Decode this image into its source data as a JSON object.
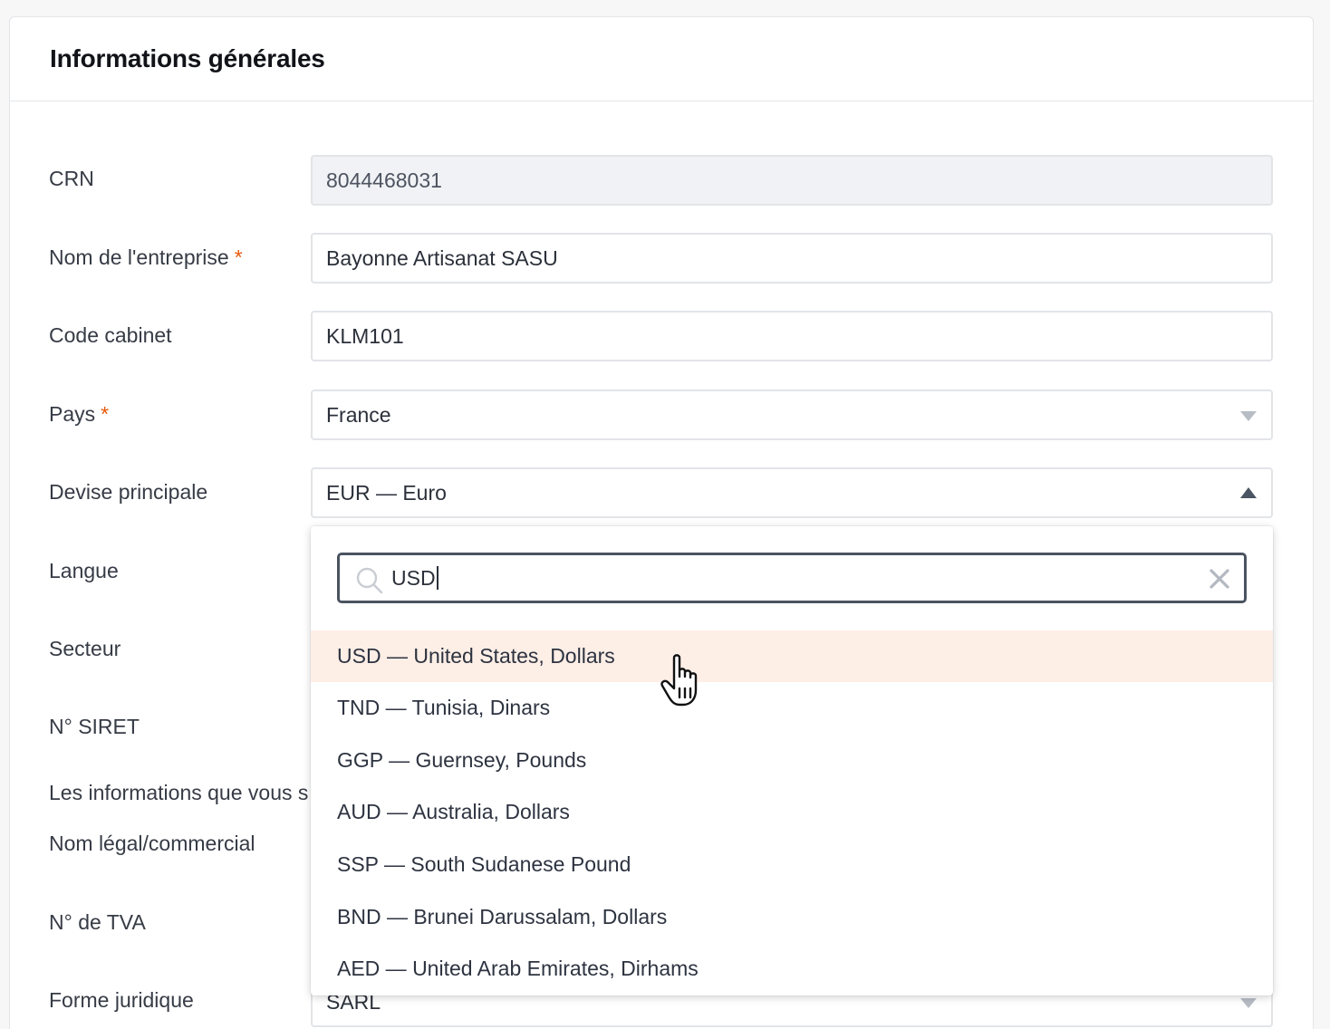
{
  "card": {
    "title": "Informations générales"
  },
  "fields": {
    "crn": {
      "label": "CRN",
      "value": "8044468031"
    },
    "company_name": {
      "label": "Nom de l'entreprise",
      "required_mark": "*",
      "value": "Bayonne Artisanat SASU"
    },
    "firm_code": {
      "label": "Code cabinet",
      "value": "KLM101"
    },
    "country": {
      "label": "Pays",
      "required_mark": "*",
      "value": "France"
    },
    "currency": {
      "label": "Devise principale",
      "value": "EUR — Euro"
    },
    "language": {
      "label": "Langue"
    },
    "sector": {
      "label": "Secteur"
    },
    "siret": {
      "label": "N° SIRET"
    },
    "info_note": {
      "label": "Les informations que vous s"
    },
    "legal_name": {
      "label": "Nom légal/commercial"
    },
    "vat": {
      "label": "N° de TVA"
    },
    "legal_form": {
      "label": "Forme juridique",
      "value": "SARL"
    }
  },
  "currency_dropdown": {
    "search_value": "USD",
    "options": [
      {
        "label": "USD — United States, Dollars",
        "highlighted": true
      },
      {
        "label": "TND — Tunisia, Dinars"
      },
      {
        "label": "GGP — Guernsey, Pounds"
      },
      {
        "label": "AUD — Australia, Dollars"
      },
      {
        "label": "SSP — South Sudanese Pound"
      },
      {
        "label": "BND — Brunei Darussalam, Dollars"
      },
      {
        "label": "AED — United Arab Emirates, Dirhams"
      }
    ]
  },
  "colors": {
    "required": "#e8590c",
    "highlight": "#fdeee6",
    "readonly_bg": "#f0f2f5",
    "search_border": "#4a5360"
  },
  "icons": {
    "search": "search-icon",
    "clear": "close-icon",
    "caret_down": "chevron-down-icon",
    "caret_up": "chevron-up-icon",
    "cursor": "hand-pointer-icon"
  }
}
